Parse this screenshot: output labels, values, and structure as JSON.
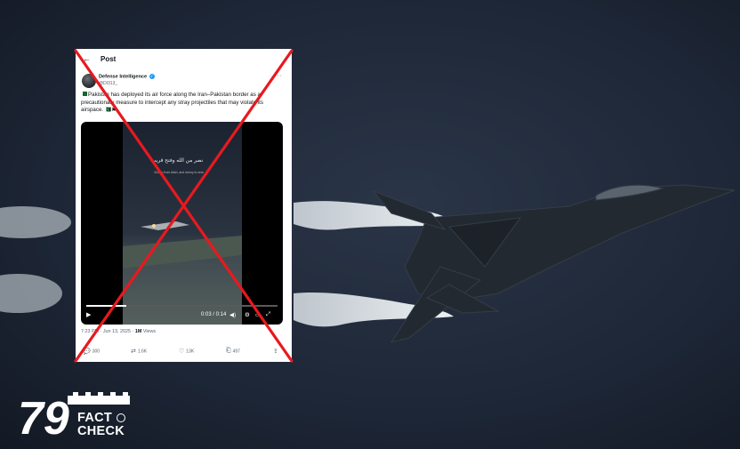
{
  "post": {
    "header": "Post",
    "author_name": "Defense Intelligence",
    "handle": "@DI313_",
    "text": "Pakistan has deployed its air force along the Iran–Pakistan border as a precautionary measure to intercept any stray projectiles that may violate its airspace.",
    "video": {
      "arabic_caption": "نصر من الله وفتح قريب",
      "english_caption": "Victory from Allah, and victory is near",
      "timecode": "0:03 / 0:14",
      "progress_fraction": 0.21
    },
    "timestamp": "7:23 PM · Jun 13, 2025 · ",
    "views": "1M",
    "views_label": " Views",
    "actions": {
      "replies": "300",
      "reposts": "1.6K",
      "likes": "13K",
      "bookmarks": "497"
    }
  },
  "overlay": {
    "stamp": "cross",
    "stamp_color": "#e8191f"
  },
  "brand": {
    "logo_number": "79",
    "line1": "FACT",
    "line2": "CHECK"
  },
  "colors": {
    "background": "#1b2434",
    "verified": "#1d9bf0",
    "text_primary": "#0f1419",
    "text_secondary": "#536471"
  }
}
